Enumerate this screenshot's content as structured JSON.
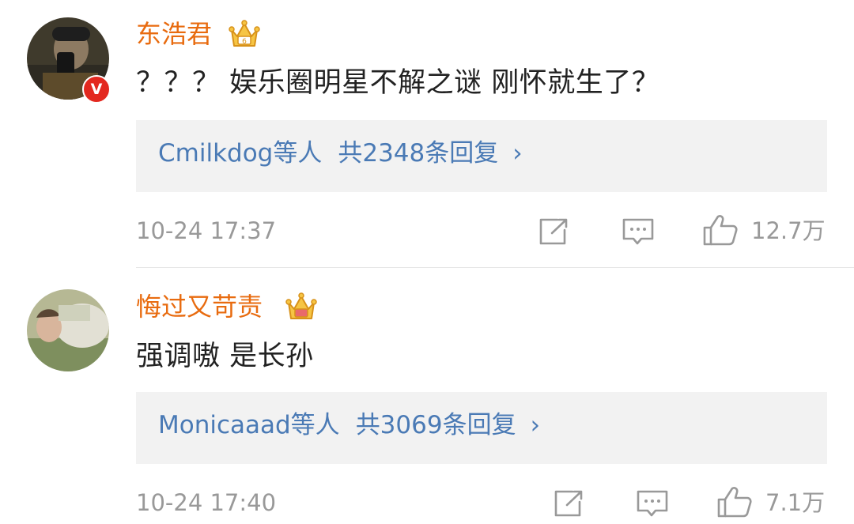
{
  "comments": [
    {
      "username": "东浩君",
      "text": "？？？ 娱乐圈明星不解之谜 刚怀就生了？",
      "replies": {
        "users": "Cmilkdog等人",
        "total": "共2348条回复",
        "chevron": "›"
      },
      "time": "10-24 17:37",
      "likes": "12.7万",
      "verified_badge": "V",
      "crown_level": "6"
    },
    {
      "username": "悔过又苛责",
      "text": "强调嗷 是长孙",
      "replies": {
        "users": "Monicaaad等人",
        "total": "共3069条回复",
        "chevron": "›"
      },
      "time": "10-24 17:40",
      "likes": "7.1万"
    }
  ],
  "colors": {
    "username": "#e86b0f",
    "reply_link": "#4a7ab5",
    "meta": "#999999",
    "reply_bg": "#f2f2f2",
    "verified": "#e3281f"
  },
  "icons": [
    "share-icon",
    "comment-icon",
    "like-icon",
    "crown-icon",
    "verified-icon"
  ]
}
